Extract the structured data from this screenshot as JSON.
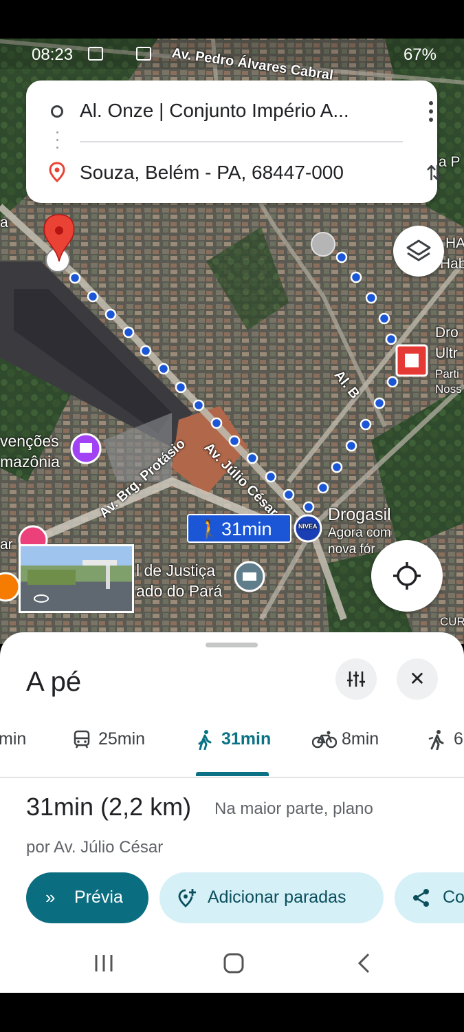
{
  "status_bar": {
    "time": "08:23",
    "battery": "67%"
  },
  "search": {
    "origin": "Al. Onze | Conjunto Império A...",
    "destination": "Souza, Belém - PA, 68447-000"
  },
  "map": {
    "travel_time_chip": "31min",
    "road_labels": {
      "top": "Av. Pedro Álvares Cabral",
      "julio": "Av. Júlio César",
      "protasio": "Av. Brg. Protásio",
      "alb": "Al. B"
    },
    "place_labels": {
      "drogasil_name": "Drogasil",
      "drogasil_sub1": "Agora com",
      "drogasil_sub2": "nova fór",
      "convencoes1": "venções",
      "convencoes2": "mazônia",
      "justica1": "l de Justiça",
      "justica2": "ado do Pará",
      "right_dro1": "Dro",
      "right_dro2": "Ultr",
      "right_dro3": "Parti",
      "right_dro4": "Noss",
      "right_ha1": "HA",
      "right_ha2": "Hab",
      "right_p": "a P",
      "left_a": "a",
      "left_ar": "ar",
      "cur": "CUR",
      "nivea": "NIVEA"
    }
  },
  "sheet": {
    "title": "A pé",
    "modes": [
      {
        "icon": "car-icon",
        "label": "min"
      },
      {
        "icon": "transit-icon",
        "label": "25min"
      },
      {
        "icon": "walk-icon",
        "label": "31min"
      },
      {
        "icon": "bike-icon",
        "label": "8min"
      },
      {
        "icon": "ride-icon",
        "label": "6"
      }
    ],
    "active_mode": 2,
    "summary_time": "31min (2,2 km)",
    "summary_note": "Na maior parte, plano",
    "via": "por Av. Júlio César",
    "buttons": {
      "preview": "Prévia",
      "add_stops": "Adicionar paradas",
      "share": "Co"
    }
  },
  "colors": {
    "accent": "#0b6e80",
    "route_dot": "#1a56d6",
    "chip": "#1a56d6",
    "pin": "#ea4335"
  }
}
